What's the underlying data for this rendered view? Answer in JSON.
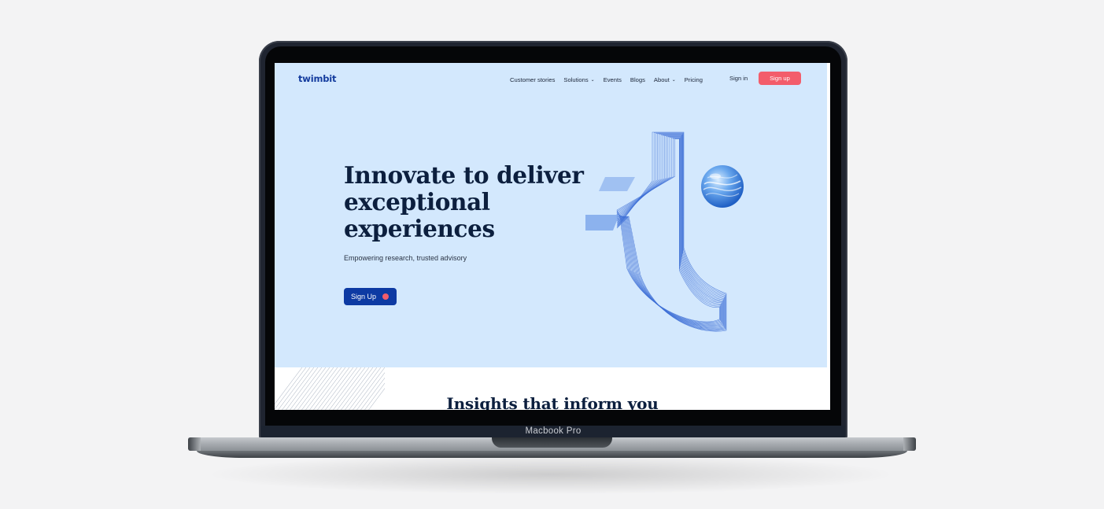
{
  "device": {
    "label": "Macbook Pro"
  },
  "header": {
    "logo_text": "twimbit",
    "nav": [
      {
        "label": "Customer stories",
        "has_dropdown": false
      },
      {
        "label": "Solutions",
        "has_dropdown": true
      },
      {
        "label": "Events",
        "has_dropdown": false
      },
      {
        "label": "Blogs",
        "has_dropdown": false
      },
      {
        "label": "About",
        "has_dropdown": true
      },
      {
        "label": "Pricing",
        "has_dropdown": false
      }
    ],
    "signin_label": "Sign in",
    "signup_label": "Sign up"
  },
  "hero": {
    "headline_lines": [
      "Innovate to deliver",
      "exceptional",
      "experiences"
    ],
    "subtitle": "Empowering research, trusted advisory",
    "cta_label": "Sign Up"
  },
  "section": {
    "title": "Insights that inform you"
  },
  "colors": {
    "hero_bg": "#d3e8fd",
    "brand_blue": "#0d3aa3",
    "accent_pink": "#f35d6b",
    "heading": "#0c1f3e"
  },
  "icons": {
    "nav_dropdown": "chevron-down-icon",
    "cta_bullet": "dot-icon"
  }
}
